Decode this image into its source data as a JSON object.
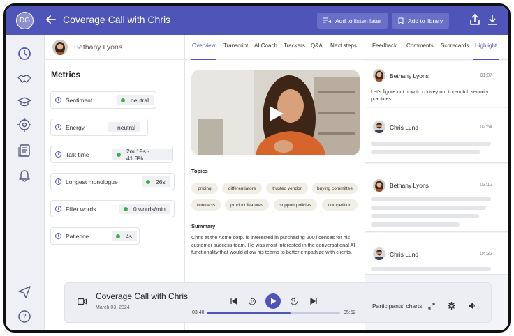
{
  "header": {
    "avatar_initials": "DG",
    "call_title": "Coverage Call with Chris",
    "listen_later_label": "Add to listen later",
    "library_label": "Add to library"
  },
  "left": {
    "participant_name": "Bethany Lyons",
    "metrics_title": "Metrics",
    "metrics": [
      {
        "label": "Sentiment",
        "value": "neutral",
        "dot": true
      },
      {
        "label": "Energy",
        "value": "neutral",
        "dot": false
      },
      {
        "label": "Talk time",
        "value": "2m 19s - 41.3%",
        "dot": true
      },
      {
        "label": "Longest monologue",
        "value": "26s",
        "dot": true
      },
      {
        "label": "Filler words",
        "value": "0 words/min",
        "dot": true
      },
      {
        "label": "Patience",
        "value": "4s",
        "dot": true
      }
    ]
  },
  "middle": {
    "tabs": [
      "Overview",
      "Transcript",
      "AI Coach",
      "Trackers",
      "Q&A",
      "Next steps"
    ],
    "active_tab": "Overview",
    "topics_title": "Topics",
    "topics": [
      "pricing",
      "differentiators",
      "trusted vendor",
      "buying committee",
      "contracts",
      "product features",
      "support policies",
      "competition"
    ],
    "summary_title": "Summary",
    "summary_text": "Chris at the Acme corp. is interested in purchasing 200 licenses for his customer success team. He was most interested in the conversational AI functionality that would allow his teams to better empathize with clients."
  },
  "right": {
    "tabs": [
      "Feedback",
      "Comments",
      "Scorecards",
      "Highlight"
    ],
    "active_tab": "Highlight",
    "entries": [
      {
        "name": "Bethany Lyons",
        "time": "01:07",
        "text": "Let's figure out how to convey our top-notch security practices."
      },
      {
        "name": "Chris Lund",
        "time": "02:54",
        "text": ""
      },
      {
        "name": "Bethany Lyons",
        "time": "03:12",
        "text": ""
      },
      {
        "name": "Chris Lund",
        "time": "04:32",
        "text": ""
      }
    ]
  },
  "player": {
    "title": "Coverage Call with Chris",
    "date": "March 03, 2024",
    "elapsed": "03:40",
    "total": "05:52",
    "progress": 0.63,
    "charts_label": "Participants' charts"
  },
  "colors": {
    "accent": "#4f54b8",
    "positive": "#3cb14a"
  }
}
